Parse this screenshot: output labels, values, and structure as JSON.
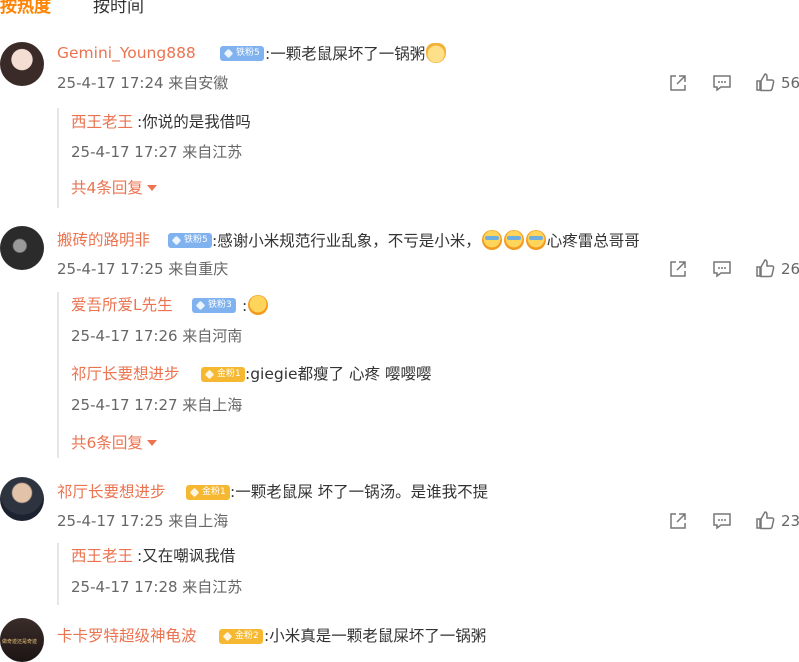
{
  "tabs": {
    "hot": "按热度",
    "time": "按时间"
  },
  "comments": [
    {
      "user": "Gemini_Young888",
      "badge": "铁粉5",
      "text": ":一颗老鼠屎坏了一锅粥",
      "emoji": "cat-emoji",
      "time": "25-4-17 17:24 来自安徽",
      "likes": "56",
      "replies": [
        {
          "user": "西王老王",
          "text": ":你说的是我借吗",
          "time": "25-4-17 17:27 来自江苏"
        }
      ],
      "more": "共4条回复"
    },
    {
      "user": "搬砖的路明非",
      "badge": "铁粉5",
      "text": ":感谢小米规范行业乱象，不亏是小米，",
      "text_after": "心疼雷总哥哥",
      "emoji": "crying-emoji",
      "time": "25-4-17 17:25 来自重庆",
      "likes": "26",
      "replies": [
        {
          "user": "爱吾所爱L先生",
          "badge": "铁粉3",
          "text": ":",
          "emoji": "laughing-emoji",
          "time": "25-4-17 17:26 来自河南"
        },
        {
          "user": "祁厅长要想进步",
          "badge": "金粉1",
          "text": ":giegie都瘦了 心疼 嘤嘤嘤",
          "time": "25-4-17 17:27 来自上海"
        }
      ],
      "more": "共6条回复"
    },
    {
      "user": "祁厅长要想进步",
      "badge": "金粉1",
      "text": ":一颗老鼠屎 坏了一锅汤。是谁我不提",
      "time": "25-4-17 17:25 来自上海",
      "likes": "23",
      "replies": [
        {
          "user": "西王老王",
          "text": ":又在嘲讽我借",
          "time": "25-4-17 17:28 来自江苏"
        }
      ]
    },
    {
      "user": "卡卡罗特超级神龟波",
      "badge": "金粉2",
      "text": ":小米真是一颗老鼠屎坏了一锅粥",
      "avatar_text": "做奇迹还是奇迹"
    }
  ],
  "colors": {
    "accent": "#ff8200",
    "username": "#eb7350",
    "badge_blue": "#7fb2ef",
    "badge_gold": "#f6b830"
  },
  "icons": {
    "share": "share-icon",
    "comment": "comment-icon",
    "like": "like-icon"
  }
}
